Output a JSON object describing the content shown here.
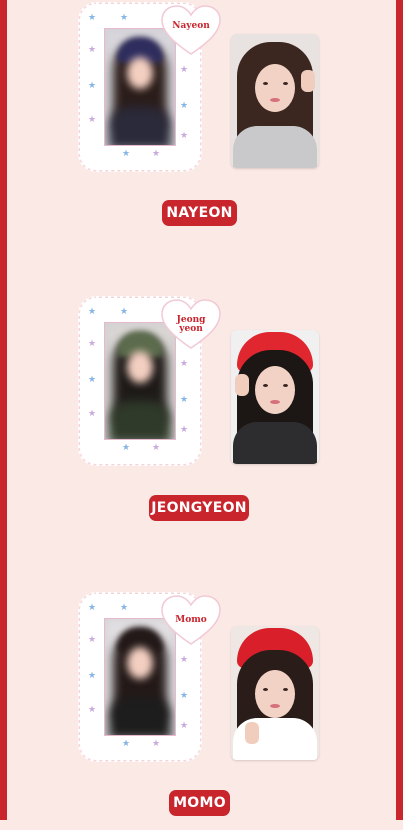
{
  "members": [
    {
      "heart_label_lines": [
        "Nayeon"
      ],
      "name": "NAYEON",
      "colors": {
        "blur_bg": "#d8d6dc",
        "blur_hair": "#2b1d1a",
        "blur_hat": "#2e2d5e",
        "blur_body": "#2a2a3a",
        "pc_bg": "#e8e2e0",
        "pc_hair": "#3b2620",
        "pc_body": "#c9c9cc"
      }
    },
    {
      "heart_label_lines": [
        "Jeong",
        "yeon"
      ],
      "name": "JEONGYEON",
      "colors": {
        "blur_bg": "#d9d5d3",
        "blur_hair": "#1e1a18",
        "blur_hat": "#5b6b4c",
        "blur_body": "#2f3a2a",
        "pc_bg": "#f1f0f0",
        "pc_hair": "#1c1614",
        "pc_body": "#2d2d2f",
        "pc_hat": "#e0262e"
      }
    },
    {
      "heart_label_lines": [
        "Momo"
      ],
      "name": "MOMO",
      "colors": {
        "blur_bg": "#e2dfe2",
        "blur_hair": "#231918",
        "blur_hat": "#231918",
        "blur_body": "#1d1d1d",
        "pc_bg": "#efe7e3",
        "pc_hair": "#2a1c18",
        "pc_body": "#ffffff",
        "pc_hat": "#d91f2a"
      }
    }
  ]
}
